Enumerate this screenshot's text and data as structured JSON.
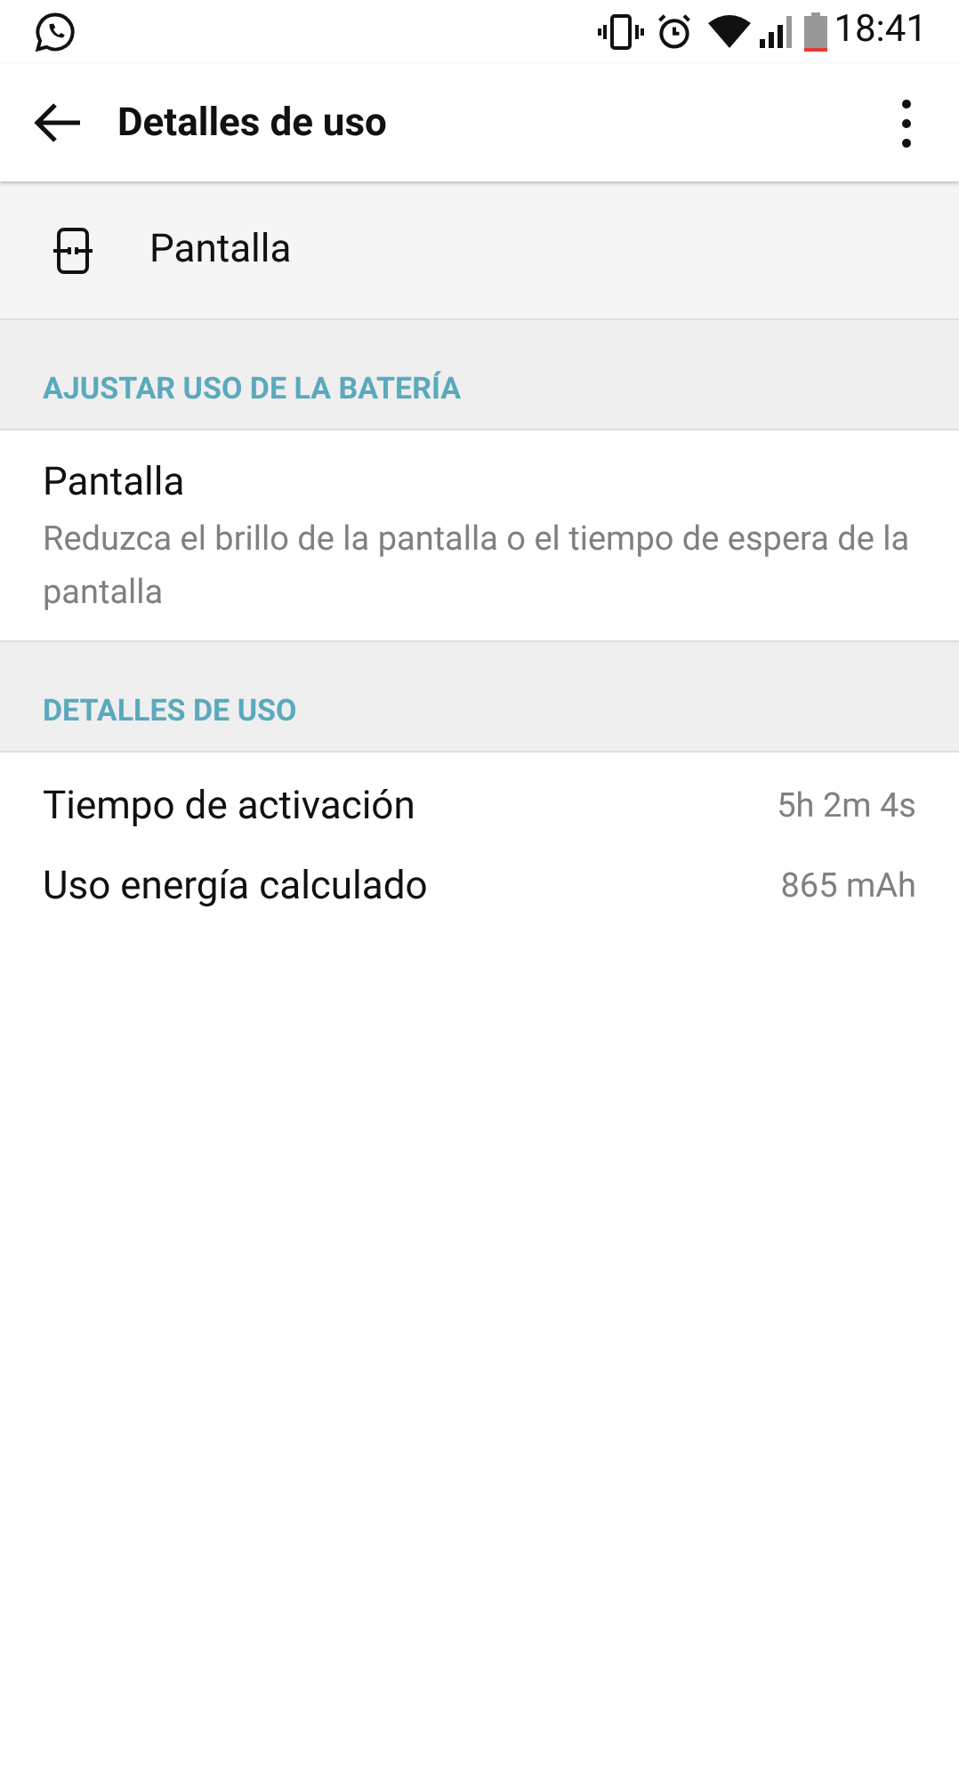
{
  "status_bar": {
    "time": "18:41"
  },
  "app_bar": {
    "title": "Detalles de uso"
  },
  "app_header": {
    "name": "Pantalla"
  },
  "sections": [
    {
      "title": "AJUSTAR USO DE LA BATERÍA",
      "items": [
        {
          "kind": "suggestion",
          "title": "Pantalla",
          "subtitle": "Reduzca el brillo de la pantalla o el tiempo de espera de la pantalla"
        }
      ]
    },
    {
      "title": "DETALLES DE USO",
      "items": [
        {
          "kind": "stat",
          "label": "Tiempo de activación",
          "value": "5h 2m 4s"
        },
        {
          "kind": "stat",
          "label": "Uso energía calculado",
          "value": "865 mAh"
        }
      ]
    }
  ]
}
